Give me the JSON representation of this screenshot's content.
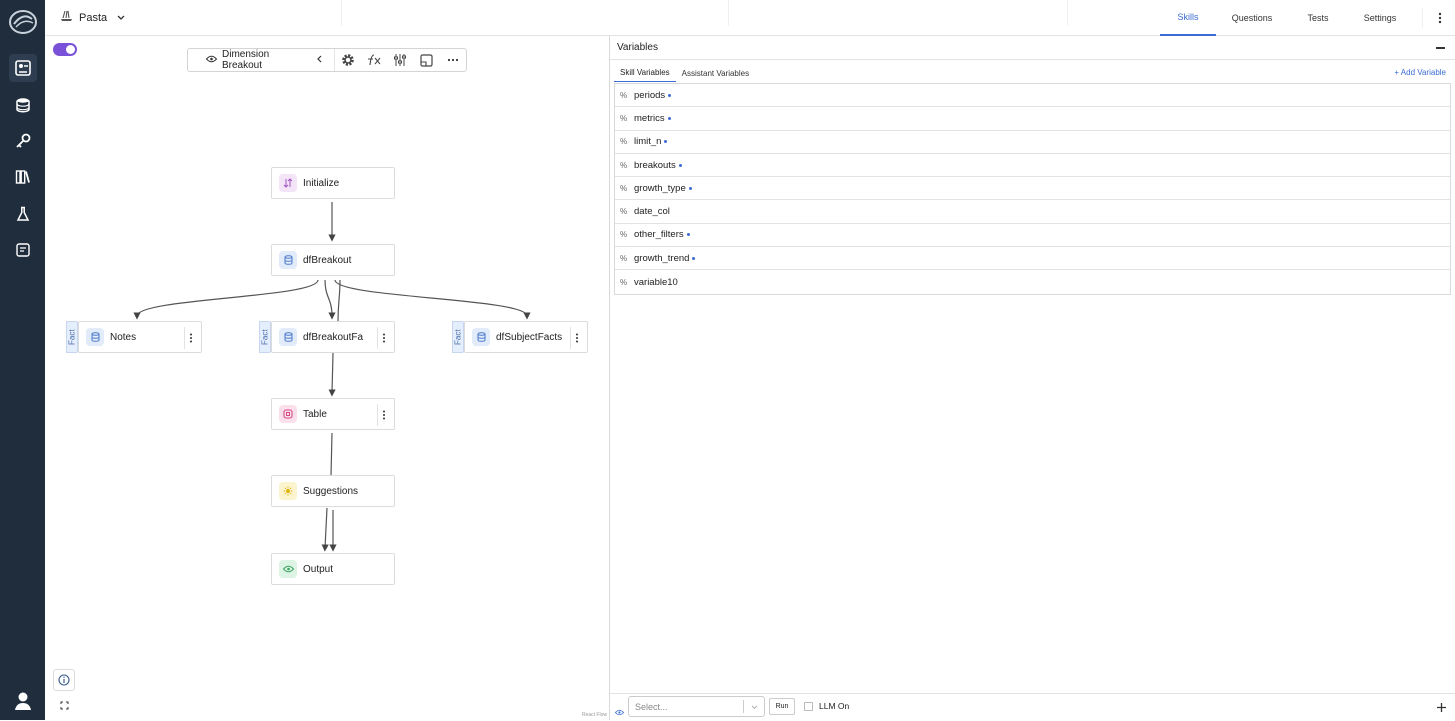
{
  "project": {
    "name": "Pasta"
  },
  "top_tabs": [
    {
      "label": "Skills",
      "active": true
    },
    {
      "label": "Questions",
      "active": false
    },
    {
      "label": "Tests",
      "active": false
    },
    {
      "label": "Settings",
      "active": false
    }
  ],
  "toolbar": {
    "skill_name": "Dimension Breakout"
  },
  "nodes": {
    "initialize": "Initialize",
    "dfbreakout": "dfBreakout",
    "notes": "Notes",
    "dfbreakoutfacts": "dfBreakoutFa",
    "dfsubjectfacts": "dfSubjectFacts",
    "table": "Table",
    "suggestions": "Suggestions",
    "output": "Output",
    "fact_tag": "Fact"
  },
  "canvas": {
    "attribution": "React Flow"
  },
  "panel": {
    "title": "Variables",
    "subtabs": [
      "Skill Variables",
      "Assistant Variables"
    ],
    "add_variable": "+ Add Variable",
    "variables": [
      {
        "name": "periods",
        "required": true
      },
      {
        "name": "metrics",
        "required": true
      },
      {
        "name": "limit_n",
        "required": true
      },
      {
        "name": "breakouts",
        "required": true
      },
      {
        "name": "growth_type",
        "required": true
      },
      {
        "name": "date_col",
        "required": false
      },
      {
        "name": "other_filters",
        "required": true
      },
      {
        "name": "growth_trend",
        "required": true
      },
      {
        "name": "variable10",
        "required": false
      }
    ],
    "bottom": {
      "select_placeholder": "Select...",
      "run_label": "Run",
      "llm_label": "LLM On"
    }
  },
  "colors": {
    "sidebar": "#1f2d3d",
    "accent": "#3b6cd6",
    "toggle": "#7a52d9"
  }
}
